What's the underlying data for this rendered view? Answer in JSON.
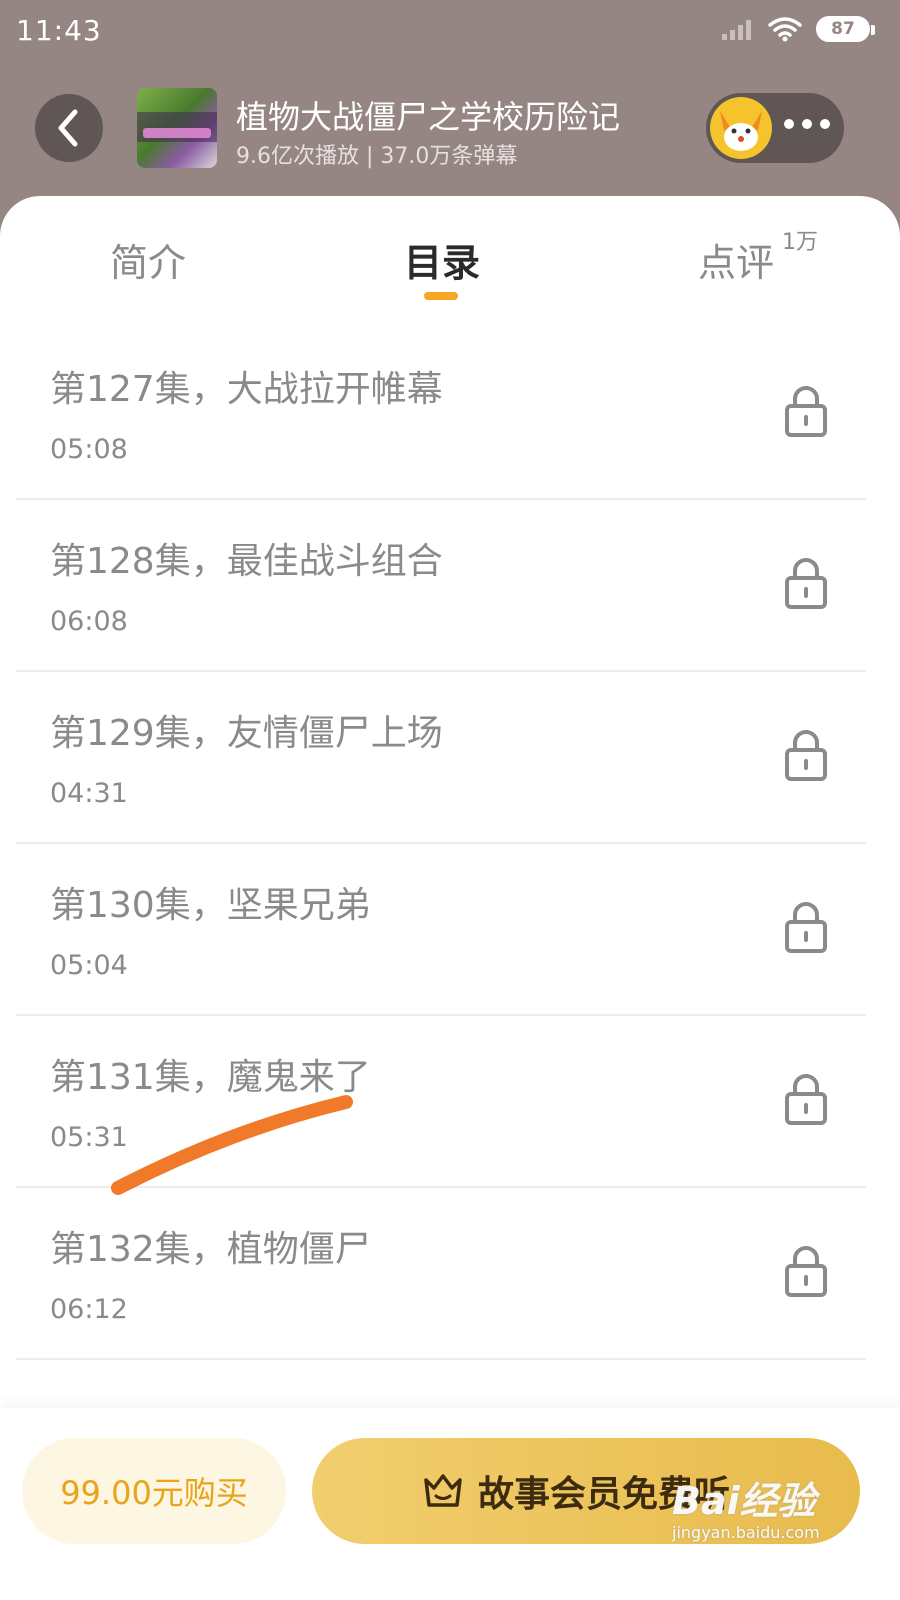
{
  "status_bar": {
    "time": "11:43",
    "battery": "87"
  },
  "header": {
    "title": "植物大战僵尸之学校历险记",
    "stats": "9.6亿次播放 | 37.0万条弹幕"
  },
  "tabs": [
    {
      "label": "简介"
    },
    {
      "label": "目录"
    },
    {
      "label": "点评",
      "badge": "1万"
    }
  ],
  "episodes": [
    {
      "title": "第127集，大战拉开帷幕",
      "duration": "05:08"
    },
    {
      "title": "第128集，最佳战斗组合",
      "duration": "06:08"
    },
    {
      "title": "第129集，友情僵尸上场",
      "duration": "04:31"
    },
    {
      "title": "第130集，坚果兄弟",
      "duration": "05:04"
    },
    {
      "title": "第131集，魔鬼来了",
      "duration": "05:31"
    },
    {
      "title": "第132集，植物僵尸",
      "duration": "06:12"
    }
  ],
  "bottom_bar": {
    "buy_label": "99.00元购买",
    "vip_label": "故事会员免费听"
  },
  "watermark": {
    "logo": "Bai经验",
    "url": "jingyan.baidu.com"
  },
  "colors": {
    "accent": "#f5a623",
    "header_bg": "#958684",
    "vip_gold": "#e8bb4c",
    "annotation": "#f07a2a"
  }
}
